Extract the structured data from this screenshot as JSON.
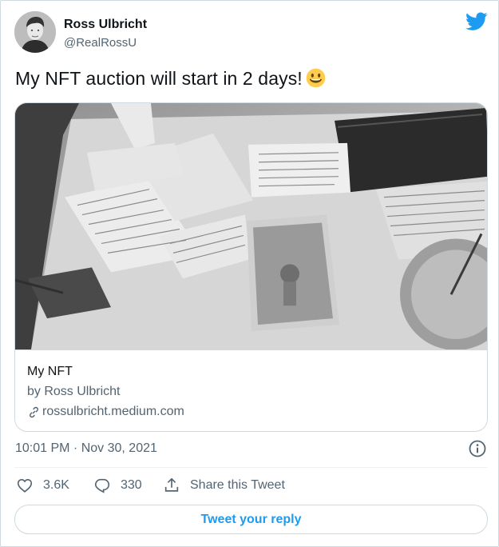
{
  "author": {
    "name": "Ross Ulbricht",
    "handle": "@RealRossU"
  },
  "tweet": {
    "text": "My NFT auction will start in 2 days!",
    "emoji": "smiley-emoji",
    "timestamp": "10:01 PM · Nov 30, 2021"
  },
  "card": {
    "title": "My NFT",
    "description": "by Ross Ulbricht",
    "link": "rossulbricht.medium.com"
  },
  "actions": {
    "like_count": "3.6K",
    "reply_count": "330",
    "share_label": "Share this Tweet"
  },
  "reply_button": "Tweet your reply",
  "colors": {
    "twitter_blue": "#1d9bf0",
    "secondary_text": "#536471",
    "border": "#cfd9de"
  },
  "icons": [
    "twitter-bird-icon",
    "smiley-emoji",
    "link-icon",
    "info-icon",
    "heart-icon",
    "reply-bubble-icon",
    "share-icon"
  ]
}
